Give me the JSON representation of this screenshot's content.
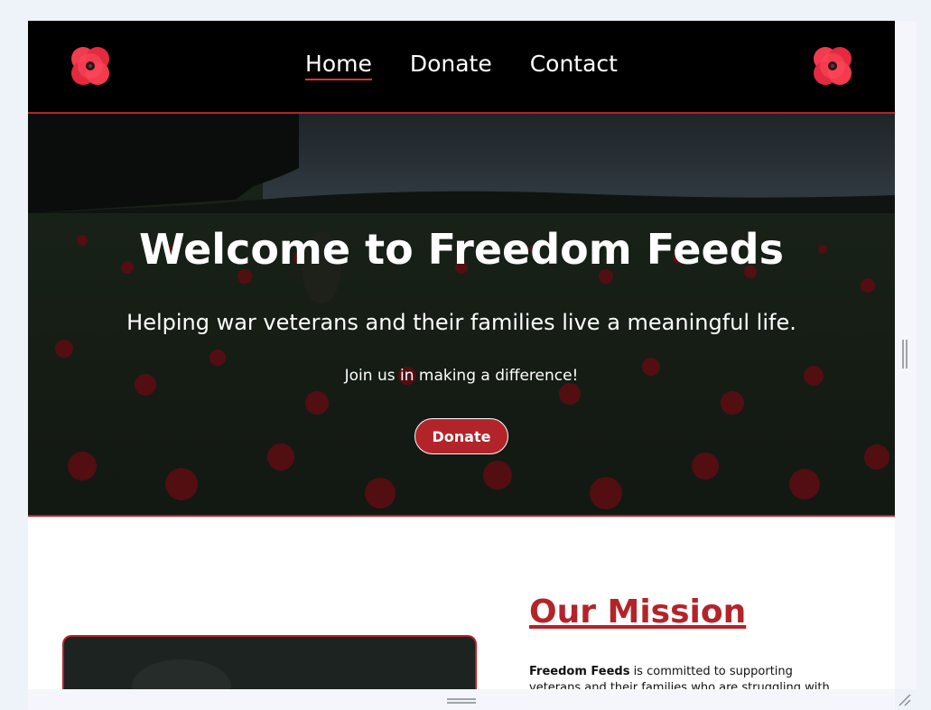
{
  "nav": {
    "links": [
      "Home",
      "Donate",
      "Contact"
    ],
    "active": "Home",
    "logo_icon": "poppy-icon"
  },
  "hero": {
    "title": "Welcome to Freedom Feeds",
    "subtitle": "Helping war veterans and their families live a meaningful life.",
    "tagline": "Join us in making a difference!",
    "donate_label": "Donate",
    "background": "poppy-field-photo"
  },
  "mission": {
    "heading": "Our Mission",
    "text_brand": "Freedom Feeds",
    "text_rest": " is committed to supporting veterans and their families who are struggling with the"
  },
  "colors": {
    "accent": "#b3242a",
    "navbar": "#000000",
    "poppy": "#ef3347"
  }
}
